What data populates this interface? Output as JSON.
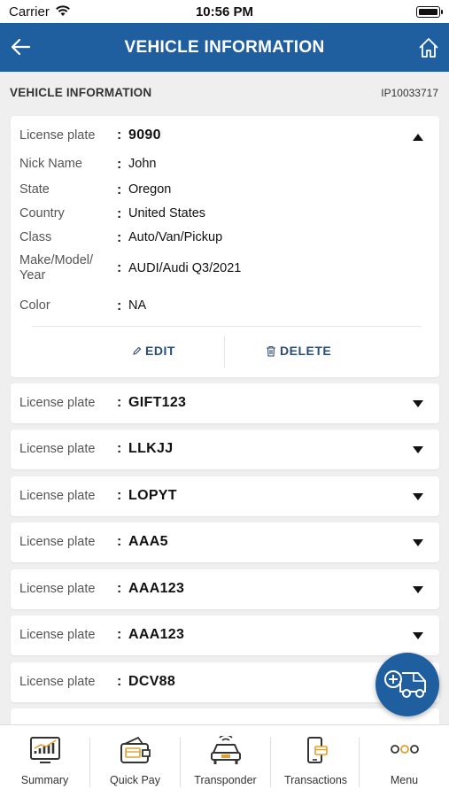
{
  "status_bar": {
    "carrier": "Carrier",
    "time": "10:56 PM"
  },
  "header": {
    "title": "VEHICLE INFORMATION"
  },
  "section": {
    "label": "VEHICLE INFORMATION",
    "account_id": "IP10033717"
  },
  "expanded_vehicle": {
    "plate_label": "License plate",
    "plate": "9090",
    "fields": [
      {
        "label": "Nick Name",
        "value": "John"
      },
      {
        "label": "State",
        "value": "Oregon"
      },
      {
        "label": "Country",
        "value": "United States"
      },
      {
        "label": "Class",
        "value": "Auto/Van/Pickup"
      },
      {
        "label": "Make/Model/\nYear",
        "value": "AUDI/Audi Q3/2021"
      },
      {
        "label": "Color",
        "value": "NA"
      }
    ],
    "edit_label": "EDIT",
    "delete_label": "DELETE"
  },
  "collapsed_vehicles": [
    {
      "label": "License plate",
      "plate": "GIFT123"
    },
    {
      "label": "License plate",
      "plate": "LLKJJ"
    },
    {
      "label": "License plate",
      "plate": "LOPYT"
    },
    {
      "label": "License plate",
      "plate": "AAA5"
    },
    {
      "label": "License plate",
      "plate": "AAA123"
    },
    {
      "label": "License plate",
      "plate": "AAA123"
    },
    {
      "label": "License plate",
      "plate": "DCV88"
    }
  ],
  "fab": {
    "icon": "add-vehicle-icon"
  },
  "bottom_nav": [
    {
      "label": "Summary",
      "icon": "summary-chart-icon"
    },
    {
      "label": "Quick Pay",
      "icon": "quick-pay-wallet-icon"
    },
    {
      "label": "Transponder",
      "icon": "transponder-car-icon"
    },
    {
      "label": "Transactions",
      "icon": "transactions-phone-icon"
    },
    {
      "label": "Menu",
      "icon": "menu-dots-icon"
    }
  ],
  "colors": {
    "header_bg": "#1f5fa0",
    "accent_text": "#2b4d73",
    "page_bg": "#efefef"
  }
}
